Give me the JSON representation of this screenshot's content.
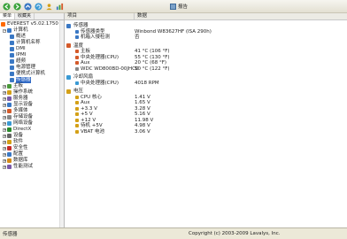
{
  "toolbar": {
    "report_label": "报告"
  },
  "left_pane": {
    "tabs": [
      "菜单",
      "收藏夹"
    ],
    "tree": [
      {
        "label": "EVEREST v5.02.1750",
        "color": "#ff6a00",
        "exp": ""
      },
      {
        "label": "计算机",
        "color": "#3a78c4",
        "exp": "−"
      },
      {
        "label": "概述",
        "color": "#3a78c4",
        "exp": ""
      },
      {
        "label": "计算机名称",
        "color": "#3a78c4",
        "exp": ""
      },
      {
        "label": "DMI",
        "color": "#3a78c4",
        "exp": ""
      },
      {
        "label": "IPMI",
        "color": "#3a78c4",
        "exp": ""
      },
      {
        "label": "超频",
        "color": "#3a78c4",
        "exp": ""
      },
      {
        "label": "电源管理",
        "color": "#3a78c4",
        "exp": ""
      },
      {
        "label": "便携式计算机",
        "color": "#3a78c4",
        "exp": ""
      },
      {
        "label": "传感器",
        "color": "#3a78c4",
        "exp": "",
        "selected": true
      },
      {
        "label": "主板",
        "color": "#4a9a3a",
        "exp": "+"
      },
      {
        "label": "操作系统",
        "color": "#d4a017",
        "exp": "+"
      },
      {
        "label": "服务器",
        "color": "#7a5aa8",
        "exp": "+"
      },
      {
        "label": "显示设备",
        "color": "#3a78c4",
        "exp": "+"
      },
      {
        "label": "多媒体",
        "color": "#d45a2a",
        "exp": "+"
      },
      {
        "label": "存储设备",
        "color": "#888888",
        "exp": "+"
      },
      {
        "label": "网络设备",
        "color": "#3a9ad4",
        "exp": "+"
      },
      {
        "label": "DirectX",
        "color": "#2a8a2a",
        "exp": "+"
      },
      {
        "label": "设备",
        "color": "#666666",
        "exp": "+"
      },
      {
        "label": "软件",
        "color": "#d4a017",
        "exp": "+"
      },
      {
        "label": "安全性",
        "color": "#c42a2a",
        "exp": "+"
      },
      {
        "label": "配置",
        "color": "#3a78c4",
        "exp": "+"
      },
      {
        "label": "数据库",
        "color": "#d48a17",
        "exp": "+"
      },
      {
        "label": "性能测试",
        "color": "#7a5aa8",
        "exp": "+"
      }
    ]
  },
  "content": {
    "col_field": "项目",
    "col_value": "数据",
    "rows": [
      {
        "type": "section",
        "label": "传感器",
        "color": "#3a78c4"
      },
      {
        "type": "item",
        "field": "传感器类型",
        "value": "Winbond W83627HF (ISA 290h)",
        "color": "#3a78c4"
      },
      {
        "type": "item",
        "field": "机箱入侵检测",
        "value": "否",
        "color": "#3a78c4"
      },
      {
        "type": "section",
        "label": "温度",
        "color": "#d45a2a"
      },
      {
        "type": "item",
        "field": "主板",
        "value": "41 °C (106 °F)",
        "color": "#d45a2a"
      },
      {
        "type": "item",
        "field": "中央处理器(CPU)",
        "value": "55 °C (130 °F)",
        "color": "#d45a2a"
      },
      {
        "type": "item",
        "field": "Aux",
        "value": "20 °C (68 °F)",
        "color": "#d45a2a"
      },
      {
        "type": "item",
        "field": "WDC WD800BD-00JHC0",
        "value": "50 °C (122 °F)",
        "color": "#888888"
      },
      {
        "type": "section",
        "label": "冷却风扇",
        "color": "#3a9ad4"
      },
      {
        "type": "item",
        "field": "中央处理器(CPU)",
        "value": "4018 RPM",
        "color": "#3a9ad4"
      },
      {
        "type": "section",
        "label": "电压",
        "color": "#d4a017"
      },
      {
        "type": "item",
        "field": "CPU 核心",
        "value": "1.41 V",
        "color": "#d4a017"
      },
      {
        "type": "item",
        "field": "Aux",
        "value": "1.65 V",
        "color": "#d4a017"
      },
      {
        "type": "item",
        "field": "+3.3 V",
        "value": "3.28 V",
        "color": "#d4a017"
      },
      {
        "type": "item",
        "field": "+5 V",
        "value": "5.16 V",
        "color": "#d4a017"
      },
      {
        "type": "item",
        "field": "+12 V",
        "value": "11.98 V",
        "color": "#d4a017"
      },
      {
        "type": "item",
        "field": "待机 +5V",
        "value": "4.98 V",
        "color": "#d4a017"
      },
      {
        "type": "item",
        "field": "VBAT 电池",
        "value": "3.06 V",
        "color": "#d4a017"
      }
    ]
  },
  "statusbar": {
    "left": "传感器",
    "right": "Copyright (c) 2003-2009 Lavalys, Inc."
  }
}
